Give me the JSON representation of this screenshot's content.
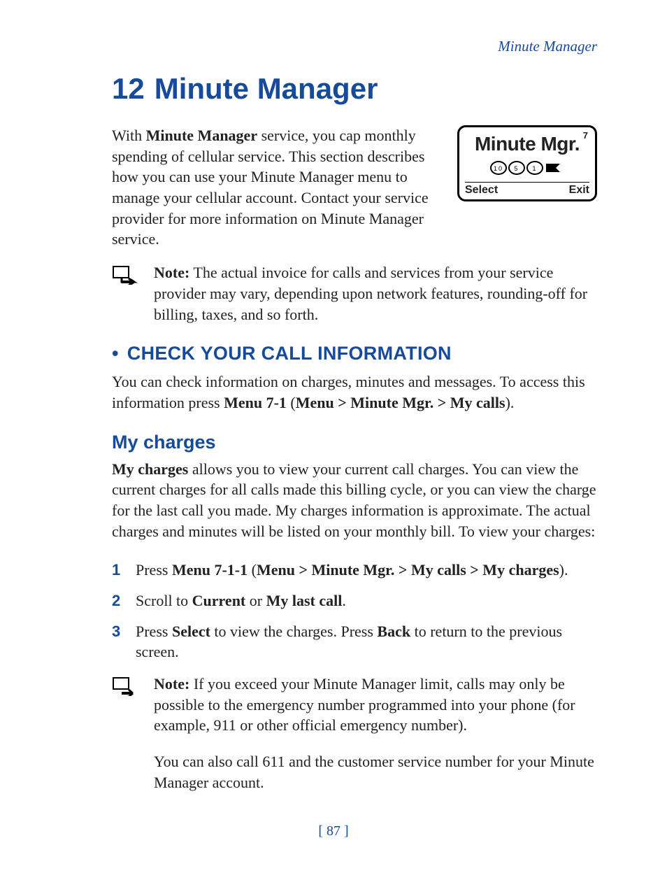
{
  "running_head": "Minute Manager",
  "chapter": {
    "number": "12",
    "title": "Minute Manager"
  },
  "intro": {
    "pre": "With ",
    "bold": "Minute Manager",
    "post": " service, you cap monthly spending of cellular service. This section describes how you can use your Minute Manager menu to manage your cellular account. Contact your service provider for more information on Minute Manager service."
  },
  "phone": {
    "badge": "7",
    "title": "Minute Mgr.",
    "soft_left": "Select",
    "soft_right": "Exit"
  },
  "note1": {
    "label": "Note:",
    "text": "  The actual invoice for calls and services from your service provider may vary, depending upon network features, rounding-off for billing, taxes, and so forth."
  },
  "section1": {
    "bullet": "•",
    "heading": "CHECK YOUR CALL INFORMATION",
    "body_pre": "You can check information on charges, minutes and messages. To access this information press ",
    "body_b1": "Menu 7-1",
    "body_mid": " (",
    "body_b2": "Menu > Minute Mgr. > My calls",
    "body_post": ")."
  },
  "sub1": {
    "heading": "My charges",
    "body_b": "My charges",
    "body_rest": " allows you to view your current call charges. You can view the current charges for all calls made this billing cycle, or you can view the charge for the last call you made. My charges information is approximate. The actual charges and minutes will be listed on your monthly bill. To view your charges:"
  },
  "steps": [
    {
      "n": "1",
      "pre": "Press ",
      "b1": "Menu 7-1-1",
      "mid": " (",
      "b2": "Menu > Minute Mgr. > My calls > My charges",
      "post": ")."
    },
    {
      "n": "2",
      "pre": "Scroll to ",
      "b1": "Current",
      "mid": " or ",
      "b2": "My last call",
      "post": "."
    },
    {
      "n": "3",
      "pre": "Press ",
      "b1": "Select",
      "mid": " to view the charges. Press ",
      "b2": "Back",
      "post": " to return to the previous screen."
    }
  ],
  "note2": {
    "label": "Note:",
    "text": "  If you exceed your Minute Manager limit, calls may only be possible to the emergency number programmed into your phone (for example, 911 or other official emergency number).",
    "extra": "You can also call 611 and the customer service number for your Minute Manager account."
  },
  "page_number": "[ 87 ]"
}
